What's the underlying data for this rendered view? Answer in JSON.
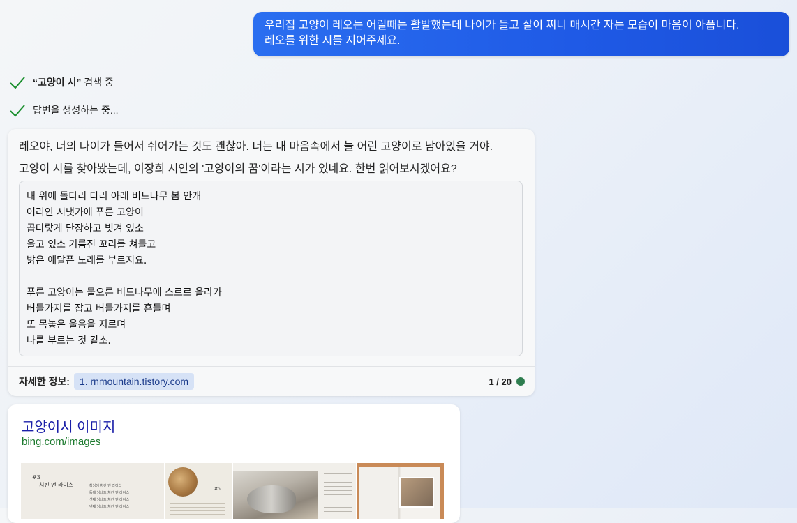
{
  "user_message": {
    "line1": "우리집 고양이 레오는 어릴때는 활발했는데 나이가 들고 살이 찌니 매시간 자는 모습이 마음이 아픕니다.",
    "line2": "레오를 위한 시를 지어주세요."
  },
  "progress": {
    "search_quote": "“고양이 시”",
    "search_suffix": " 검색 중",
    "generating": "답변을 생성하는 중..."
  },
  "answer": {
    "paragraph1": "레오야, 너의 나이가 들어서 쉬어가는 것도 괜찮아. 너는 내 마음속에서 늘 어린 고양이로 남아있을 거야.",
    "paragraph2": "고양이 시를 찾아봤는데, 이장희 시인의 '고양이의 꿈'이라는 시가 있네요. 한번 읽어보시겠어요?",
    "poem_lines": [
      "내 위에 돌다리 다리 아래 버드나무 봄 안개",
      "어리인 시냇가에 푸른 고양이",
      "곱다랗게 단장하고 빗겨 있소",
      "울고 있소 기름진 꼬리를 쳐들고",
      "밝은 애달픈 노래를 부르지요.",
      "",
      "푸른 고양이는 물오른 버드나무에 스르르 올라가",
      "버들가지를 잡고 버들가지를 흔들며",
      "또 목놓은 울음을 지르며",
      "나를 부르는 것 같소."
    ],
    "footer_label": "자세한 정보:",
    "source": "1. rnmountain.tistory.com",
    "counter": "1 / 20",
    "status_color": "#2e7d4f"
  },
  "image_card": {
    "title": "고양이시 이미지",
    "url": "bing.com/images",
    "thumbs": [
      {
        "heading": "#3",
        "subheading": "치킨 앤 라이스",
        "lines": [
          "창닝에 치킨 앤 라이스",
          "둥에 닝네도 치킨 앤 라이스",
          "셋째 닝네도 치킨 앤 라이스",
          "넷째 닝네도 치킨 앤 라이스"
        ]
      },
      {
        "heading": "#5"
      },
      {
        "heading": ""
      },
      {
        "heading": ""
      }
    ]
  },
  "colors": {
    "user_bubble": "#1f5ae6",
    "check": "#1a8f2e",
    "link_title": "#1a1fa8",
    "link_url": "#1c7a2e"
  }
}
